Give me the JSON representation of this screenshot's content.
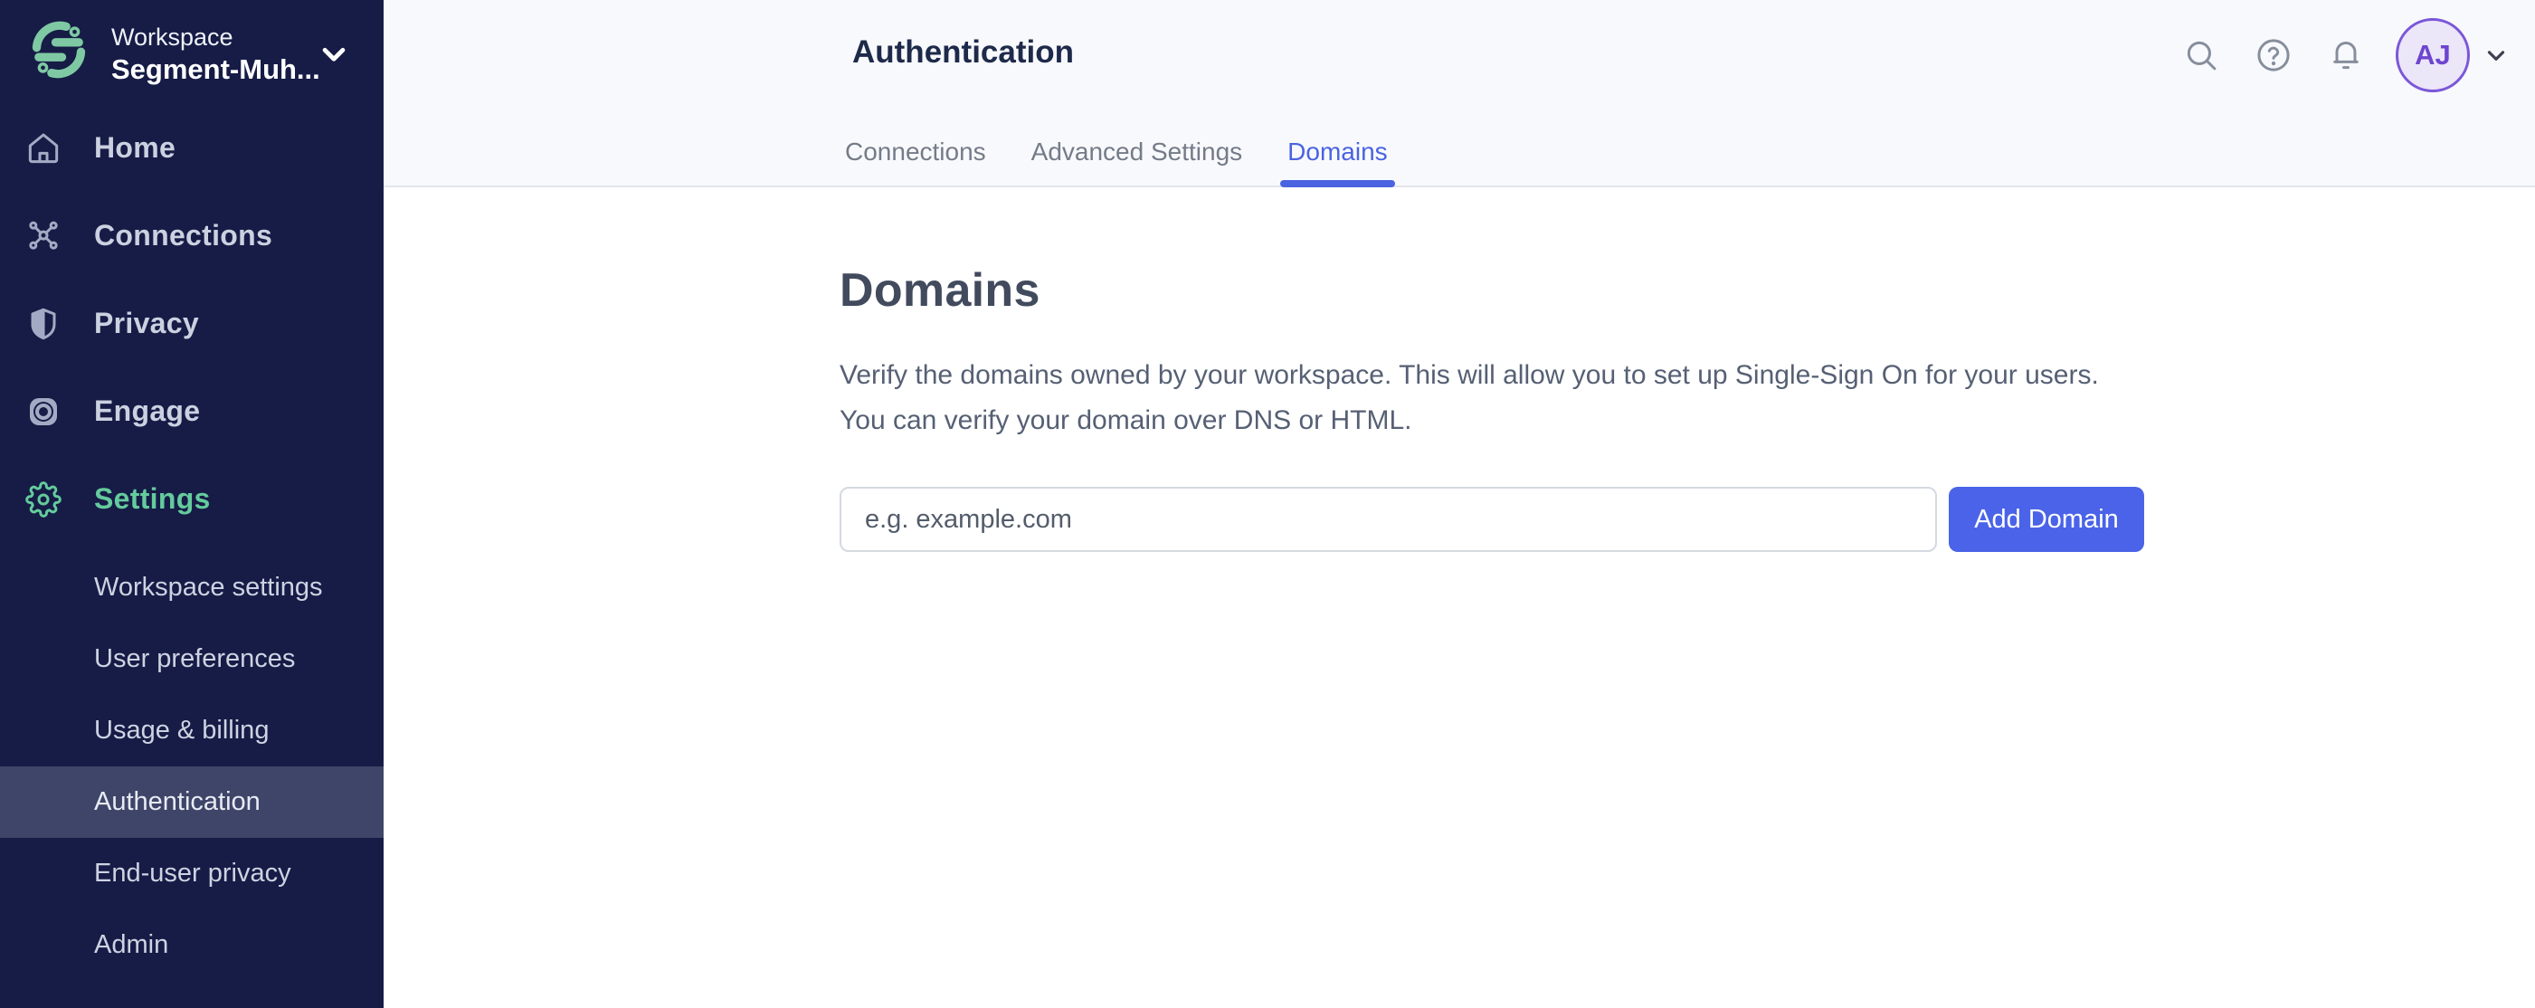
{
  "sidebar": {
    "workspace_label": "Workspace",
    "workspace_name": "Segment-Muh...",
    "items": [
      {
        "label": "Home",
        "icon": "home-icon",
        "active": false
      },
      {
        "label": "Connections",
        "icon": "connections-icon",
        "active": false
      },
      {
        "label": "Privacy",
        "icon": "shield-icon",
        "active": false
      },
      {
        "label": "Engage",
        "icon": "engage-icon",
        "active": false
      },
      {
        "label": "Settings",
        "icon": "gear-icon",
        "active": true
      }
    ],
    "settings_subitems": [
      {
        "label": "Workspace settings",
        "active": false
      },
      {
        "label": "User preferences",
        "active": false
      },
      {
        "label": "Usage & billing",
        "active": false
      },
      {
        "label": "Authentication",
        "active": true
      },
      {
        "label": "End-user privacy",
        "active": false
      },
      {
        "label": "Admin",
        "active": false
      }
    ]
  },
  "header": {
    "title": "Authentication",
    "tabs": [
      {
        "label": "Connections",
        "active": false
      },
      {
        "label": "Advanced Settings",
        "active": false
      },
      {
        "label": "Domains",
        "active": true
      }
    ],
    "icons": [
      "search-icon",
      "help-icon",
      "bell-icon"
    ],
    "avatar_initials": "AJ"
  },
  "main": {
    "heading": "Domains",
    "description": "Verify the domains owned by your workspace. This will allow you to set up Single-Sign On for your users. You can verify your domain over DNS or HTML.",
    "domain_input_placeholder": "e.g. example.com",
    "domain_input_value": "",
    "add_domain_button": "Add Domain"
  },
  "colors": {
    "sidebar_bg": "#161c46",
    "sidebar_active_row": "#3e4568",
    "accent_green": "#64cb9d",
    "logo_green": "#7ec9a3",
    "accent_blue": "#4a63e0",
    "button_blue": "#4a63e8",
    "header_bg": "#f8f9fc",
    "avatar_bg": "#ece6f9",
    "avatar_border": "#7b57d8",
    "avatar_text": "#6d45cf"
  }
}
